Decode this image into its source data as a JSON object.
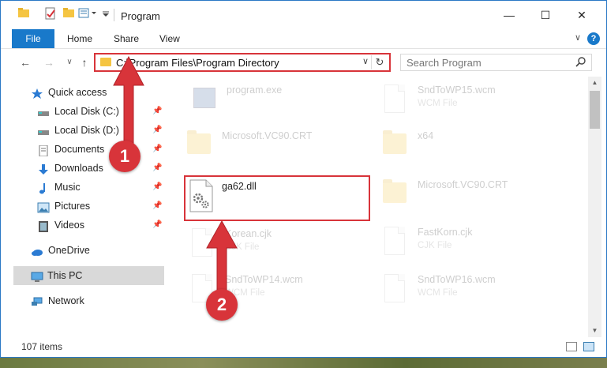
{
  "window": {
    "title": "Program",
    "minimize_glyph": "—",
    "maximize_glyph": "☐",
    "close_glyph": "✕"
  },
  "ribbon": {
    "file_tab": "File",
    "tabs": [
      "Home",
      "Share",
      "View"
    ],
    "collapse_glyph": "∨",
    "help_glyph": "?"
  },
  "nav": {
    "back_glyph": "←",
    "forward_glyph": "→",
    "recent_glyph": "∨",
    "up_glyph": "↑",
    "address": "C:\\Program Files\\Program Directory",
    "address_drop_glyph": "∨",
    "refresh_glyph": "↻",
    "search_placeholder": "Search Program",
    "search_glyph": "⚲"
  },
  "sidebar": {
    "items": [
      {
        "label": "Quick access",
        "icon": "star-icon",
        "pinned": false
      },
      {
        "label": "Local Disk (C:)",
        "icon": "drive-icon",
        "pinned": true
      },
      {
        "label": "Local Disk (D:)",
        "icon": "drive-icon",
        "pinned": true
      },
      {
        "label": "Documents",
        "icon": "documents-icon",
        "pinned": true
      },
      {
        "label": "Downloads",
        "icon": "download-icon",
        "pinned": true
      },
      {
        "label": "Music",
        "icon": "music-icon",
        "pinned": true
      },
      {
        "label": "Pictures",
        "icon": "pictures-icon",
        "pinned": true
      },
      {
        "label": "Videos",
        "icon": "videos-icon",
        "pinned": true
      },
      {
        "label": "OneDrive",
        "icon": "cloud-icon",
        "pinned": false
      },
      {
        "label": "This PC",
        "icon": "computer-icon",
        "pinned": false,
        "selected": true
      },
      {
        "label": "Network",
        "icon": "network-icon",
        "pinned": false
      }
    ],
    "pin_glyph": "📌"
  },
  "files": [
    {
      "name": "program.exe",
      "type": "",
      "icon": "exe-icon",
      "faded": true
    },
    {
      "name": "SndToWP15.wcm",
      "type": "WCM File",
      "icon": "document-icon",
      "faded": true
    },
    {
      "name": "Microsoft.VC90.CRT",
      "type": "",
      "icon": "folder-icon",
      "faded": true
    },
    {
      "name": "x64",
      "type": "",
      "icon": "folder-icon",
      "faded": true
    },
    {
      "name": "ga62.dll",
      "type": "",
      "icon": "dll-gear-icon",
      "faded": false
    },
    {
      "name": "Microsoft.VC90.CRT",
      "type": "",
      "icon": "folder-icon",
      "faded": true
    },
    {
      "name": "Korean.cjk",
      "type": "CJK File",
      "icon": "document-icon",
      "faded": true
    },
    {
      "name": "FastKorn.cjk",
      "type": "CJK File",
      "icon": "document-icon",
      "faded": true
    },
    {
      "name": "SndToWP14.wcm",
      "type": "WCM File",
      "icon": "document-icon",
      "faded": true
    },
    {
      "name": "SndToWP16.wcm",
      "type": "WCM File",
      "icon": "document-icon",
      "faded": true
    }
  ],
  "status": {
    "item_count": "107 items"
  },
  "annotations": {
    "step1": "1",
    "step2": "2"
  },
  "colors": {
    "accent": "#1979ca",
    "annotation_red": "#d8343a",
    "folder_yellow": "#f5c542",
    "selected_bg": "#d9d9d9"
  }
}
